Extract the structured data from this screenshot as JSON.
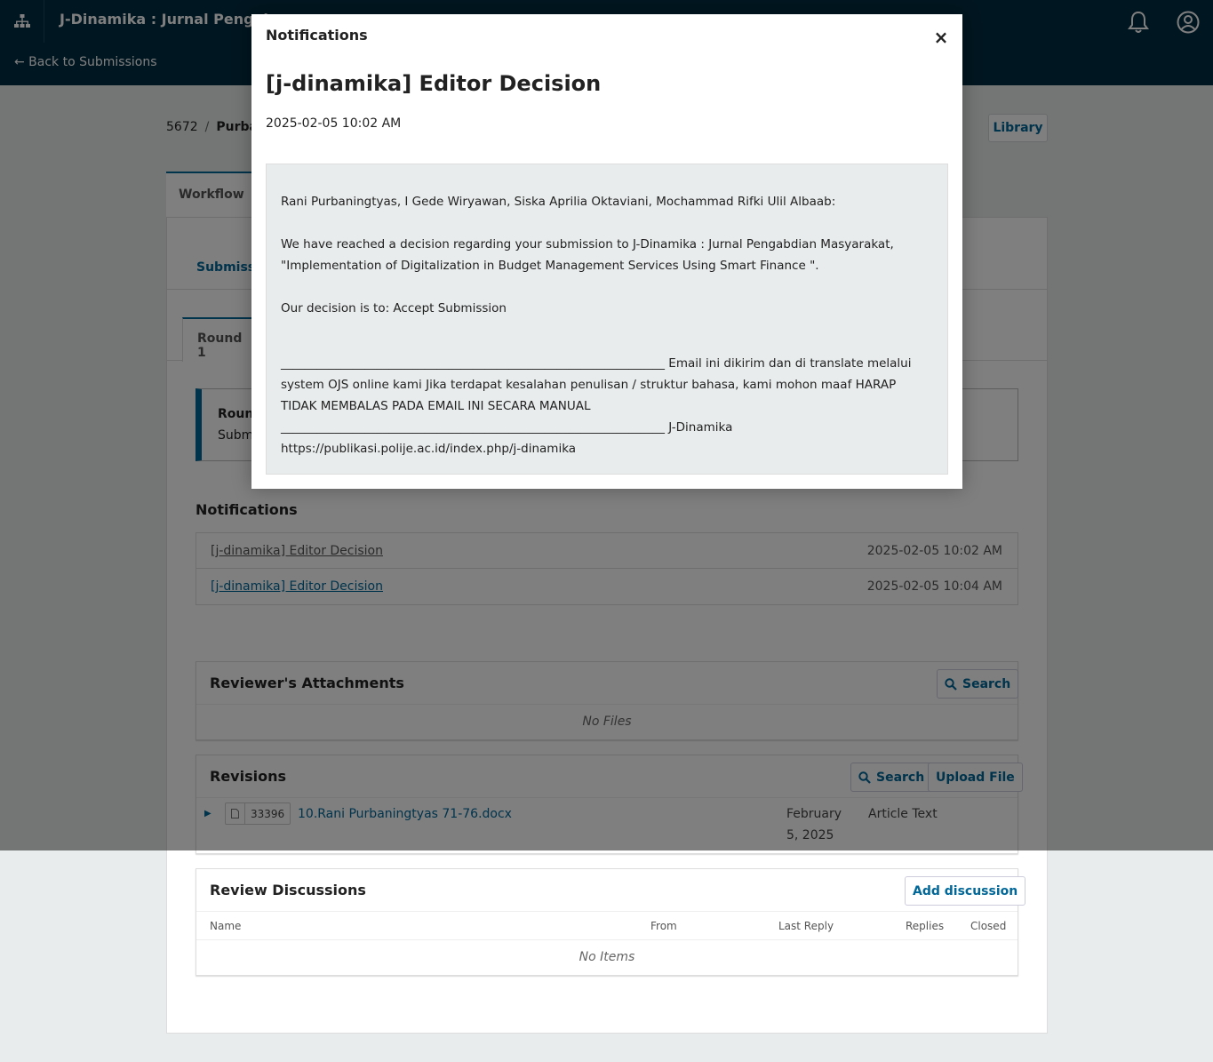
{
  "header": {
    "journal_title": "J-Dinamika : Jurnal Pengab",
    "back_link": "← Back to Submissions"
  },
  "breadcrumb": {
    "id": "5672",
    "separator": "/",
    "author": "Purba"
  },
  "library_button": "Library",
  "workflow_tab": "Workflow",
  "stage_tab": "Submissi",
  "round_tab": "Round 1",
  "round_notice": {
    "title": "Roun",
    "subtitle": "Subm"
  },
  "notifications": {
    "heading": "Notifications",
    "items": [
      {
        "label": "[j-dinamika] Editor Decision",
        "date": "2025-02-05 10:02 AM"
      },
      {
        "label": "[j-dinamika] Editor Decision",
        "date": "2025-02-05 10:04 AM"
      }
    ]
  },
  "reviewer_attachments": {
    "title": "Reviewer's Attachments",
    "search": "Search",
    "empty": "No Files"
  },
  "revisions": {
    "title": "Revisions",
    "search": "Search",
    "upload": "Upload File",
    "file": {
      "id": "33396",
      "name": "10.Rani Purbaningtyas 71-76.docx",
      "date": "February 5, 2025",
      "type": "Article Text"
    }
  },
  "review_discussions": {
    "title": "Review Discussions",
    "add": "Add discussion",
    "columns": [
      "Name",
      "From",
      "Last Reply",
      "Replies",
      "Closed"
    ],
    "empty": "No Items"
  },
  "modal": {
    "title": "Notifications",
    "close": "×",
    "heading": "[j-dinamika] Editor Decision",
    "date": "2025-02-05 10:02 AM",
    "recipients": "Rani Purbaningtyas, I Gede Wiryawan, Siska Aprilia Oktaviani, Mochammad Rifki Ulil Albaab:",
    "line1": "We have reached a decision regarding your submission to J-Dinamika : Jurnal Pengabdian Masyarakat, \"Implementation of Digitalization in Budget Management Services Using Smart Finance \".",
    "decision": "Our decision is to: Accept Submission",
    "footer1": "________________________________________________________________ Email ini dikirim dan di translate melalui system OJS online kami Jika terdapat kesalahan penulisan / struktur bahasa, kami mohon maaf HARAP TIDAK MEMBALAS PADA EMAIL INI SECARA MANUAL",
    "footer2": "________________________________________________________________ J-Dinamika",
    "url": "https://publikasi.polije.ac.id/index.php/j-dinamika"
  },
  "colors": {
    "header_bg": "#002c40",
    "accent": "#006798"
  }
}
